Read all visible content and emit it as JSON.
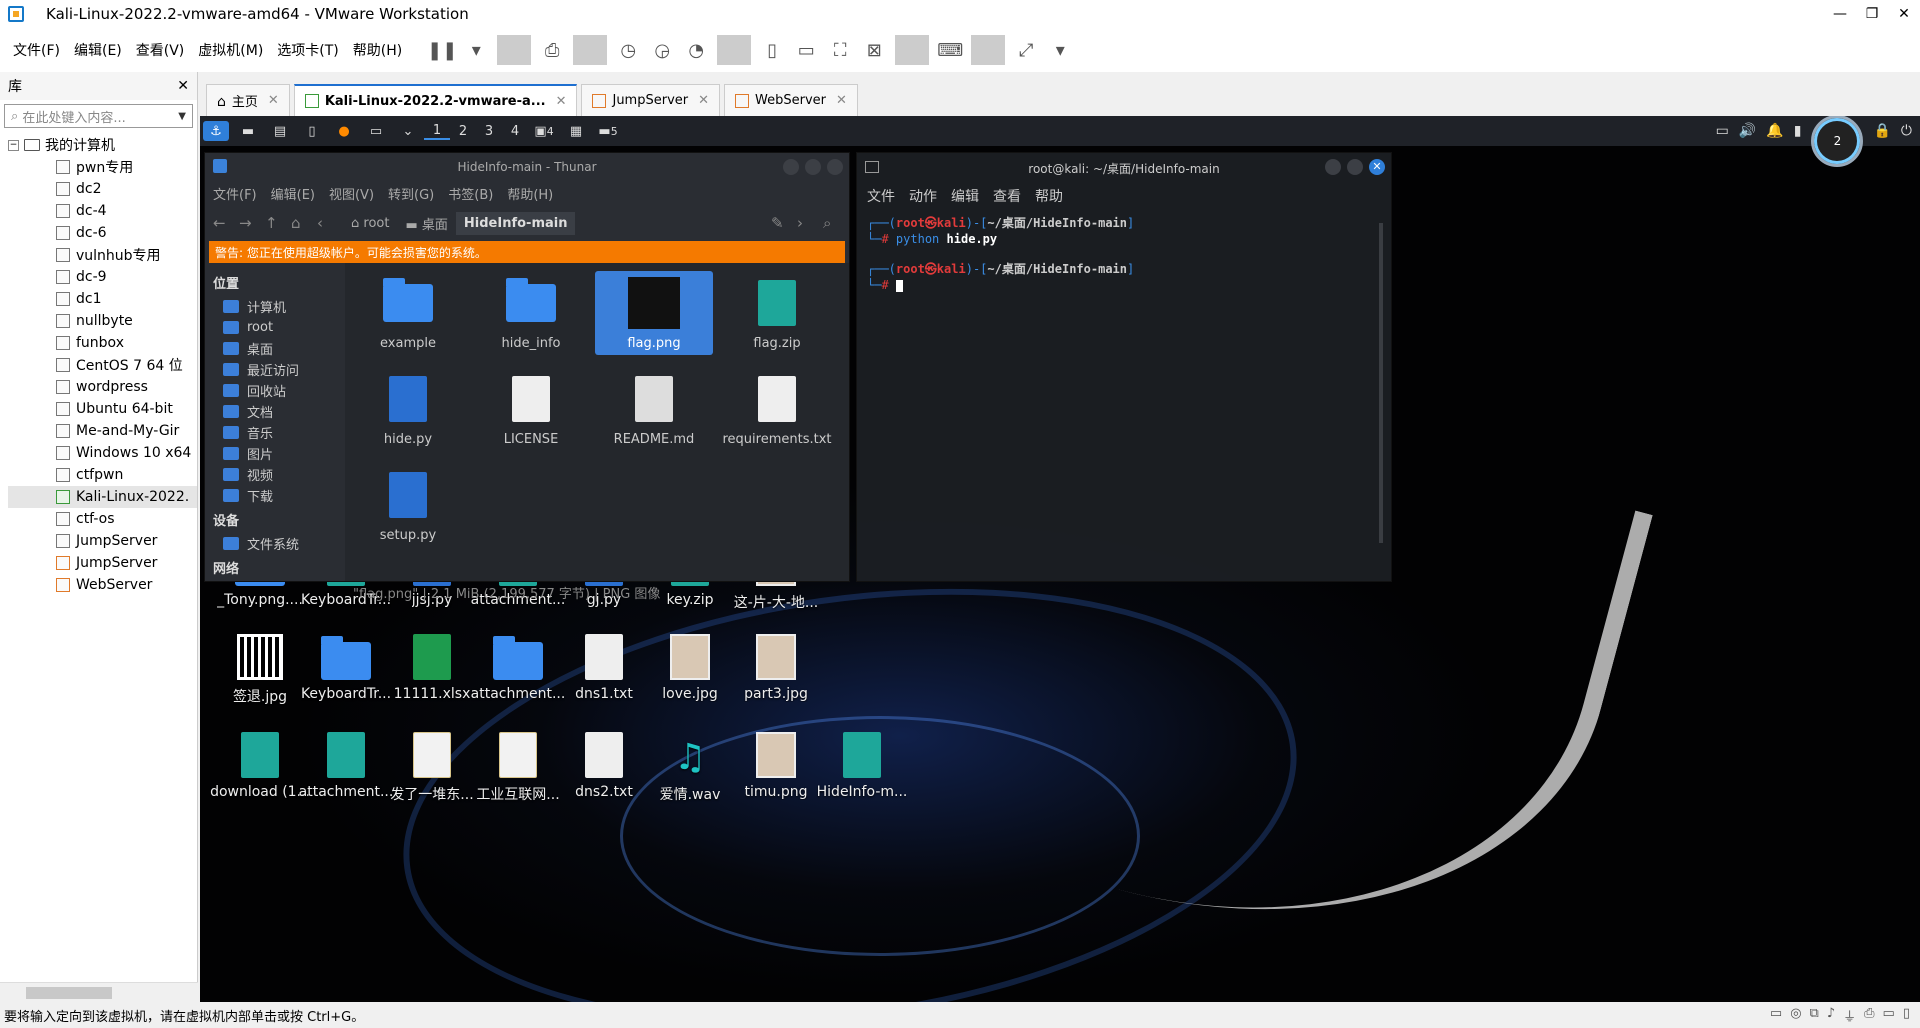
{
  "window": {
    "title": "Kali-Linux-2022.2-vmware-amd64 - VMware Workstation",
    "controls": [
      "—",
      "❐",
      "✕"
    ]
  },
  "menu": [
    "文件(F)",
    "编辑(E)",
    "查看(V)",
    "虚拟机(M)",
    "选项卡(T)",
    "帮助(H)"
  ],
  "library": {
    "title": "库",
    "close": "✕",
    "search_placeholder": "在此处键入内容...",
    "root": "我的计算机",
    "items": [
      {
        "name": "pwn专用",
        "kind": "vm"
      },
      {
        "name": "dc2",
        "kind": "vm"
      },
      {
        "name": "dc-4",
        "kind": "vm"
      },
      {
        "name": "dc-6",
        "kind": "vm"
      },
      {
        "name": "vulnhub专用",
        "kind": "vm"
      },
      {
        "name": "dc-9",
        "kind": "vm"
      },
      {
        "name": "dc1",
        "kind": "vm"
      },
      {
        "name": "nullbyte",
        "kind": "vm"
      },
      {
        "name": "funbox",
        "kind": "vm"
      },
      {
        "name": "CentOS 7 64 位",
        "kind": "vm"
      },
      {
        "name": "wordpress",
        "kind": "vm"
      },
      {
        "name": "Ubuntu 64-bit",
        "kind": "vm"
      },
      {
        "name": "Me-and-My-Gir",
        "kind": "vm"
      },
      {
        "name": "Windows 10 x64",
        "kind": "vm"
      },
      {
        "name": "ctfpwn",
        "kind": "vm"
      },
      {
        "name": "Kali-Linux-2022.",
        "kind": "running"
      },
      {
        "name": "ctf-os",
        "kind": "vm"
      },
      {
        "name": "JumpServer",
        "kind": "vm"
      },
      {
        "name": "JumpServer",
        "kind": "shared"
      },
      {
        "name": "WebServer",
        "kind": "shared"
      }
    ]
  },
  "tabs": [
    {
      "label": "主页",
      "icon": "home-icon"
    },
    {
      "label": "Kali-Linux-2022.2-vmware-a...",
      "icon": "vm-icon",
      "active": true
    },
    {
      "label": "JumpServer",
      "icon": "shared-vm-icon"
    },
    {
      "label": "WebServer",
      "icon": "shared-vm-icon"
    }
  ],
  "status": {
    "text": "要将输入定向到该虚拟机，请在虚拟机内部单击或按 Ctrl+G。"
  },
  "kali_panel": {
    "workspaces": [
      "1",
      "2",
      "3",
      "4"
    ],
    "badge1": "4",
    "badge2": "5",
    "clock": "2"
  },
  "thunar": {
    "title": "HideInfo-main - Thunar",
    "menu": [
      "文件(F)",
      "编辑(E)",
      "视图(V)",
      "转到(G)",
      "书签(B)",
      "帮助(H)"
    ],
    "crumbs": [
      "root",
      "桌面",
      "HideInfo-main"
    ],
    "warning": "警告: 您正在使用超级帐户。可能会损害您的系统。",
    "sidebar": {
      "places_title": "位置",
      "places": [
        "计算机",
        "root",
        "桌面",
        "最近访问",
        "回收站",
        "文档",
        "音乐",
        "图片",
        "视频",
        "下载"
      ],
      "devices_title": "设备",
      "devices": [
        "文件系统"
      ],
      "network_title": "网络"
    },
    "files": [
      {
        "name": "example",
        "type": "folder"
      },
      {
        "name": "hide_info",
        "type": "folder"
      },
      {
        "name": "flag.png",
        "type": "image",
        "selected": true
      },
      {
        "name": "flag.zip",
        "type": "zip"
      },
      {
        "name": "hide.py",
        "type": "py"
      },
      {
        "name": "LICENSE",
        "type": "text"
      },
      {
        "name": "README.md",
        "type": "md"
      },
      {
        "name": "requirements.txt",
        "type": "text"
      },
      {
        "name": "setup.py",
        "type": "py"
      }
    ],
    "statusbar": "\"flag.png\" | 2.1 MiB (2,199,577 字节) | PNG 图像"
  },
  "terminal": {
    "title": "root@kali: ~/桌面/HideInfo-main",
    "menu": [
      "文件",
      "动作",
      "编辑",
      "查看",
      "帮助"
    ],
    "prompt_user": "root㉿kali",
    "prompt_dir": "~/桌面/HideInfo-main",
    "prompt_hash": "#",
    "command_prefix": "python",
    "command_arg": "hide.py"
  },
  "desktop": [
    {
      "name": "_Tony.png....",
      "type": "folder"
    },
    {
      "name": "KeyboardTr...",
      "type": "zip"
    },
    {
      "name": "jjsj.py",
      "type": "py"
    },
    {
      "name": "attachment...",
      "type": "zip"
    },
    {
      "name": "gj.py",
      "type": "py"
    },
    {
      "name": "key.zip",
      "type": "zip"
    },
    {
      "name": "这-片-大-地...",
      "type": "img"
    },
    {
      "name": "签退.jpg",
      "type": "qr"
    },
    {
      "name": "KeyboardTr...",
      "type": "folder"
    },
    {
      "name": "11111.xlsx",
      "type": "xlsx"
    },
    {
      "name": "attachment...",
      "type": "folder"
    },
    {
      "name": "dns1.txt",
      "type": "text"
    },
    {
      "name": "love.jpg",
      "type": "img"
    },
    {
      "name": "part3.jpg",
      "type": "img"
    },
    {
      "name": "download (1...",
      "type": "zip"
    },
    {
      "name": "attachment...",
      "type": "zip"
    },
    {
      "name": "发了一堆东...",
      "type": "bin"
    },
    {
      "name": "工业互联网...",
      "type": "bin"
    },
    {
      "name": "dns2.txt",
      "type": "text"
    },
    {
      "name": "爱情.wav",
      "type": "audio"
    },
    {
      "name": "timu.png",
      "type": "img"
    },
    {
      "name": "HideInfo-m...",
      "type": "zip"
    }
  ]
}
